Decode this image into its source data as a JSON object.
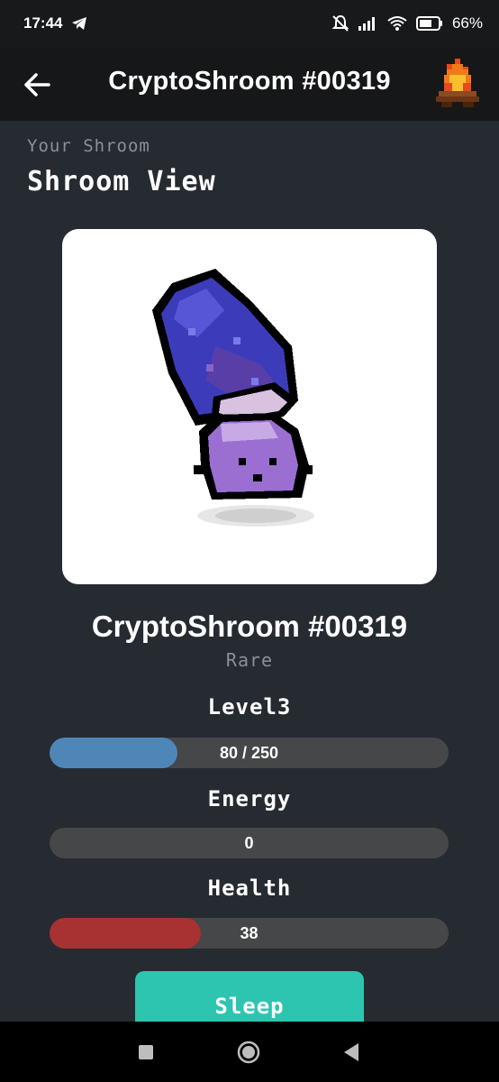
{
  "status_bar": {
    "time": "17:44",
    "battery": "66%",
    "icons": [
      "telegram-icon",
      "mute-icon",
      "signal-icon",
      "wifi-icon",
      "battery-icon"
    ]
  },
  "header": {
    "title": "CryptoShroom #00319",
    "back_icon": "arrow-left-icon",
    "campfire_icon": "campfire-icon"
  },
  "page": {
    "subheading": "Your Shroom",
    "heading": "Shroom View"
  },
  "shroom": {
    "name": "CryptoShroom #00319",
    "rarity": "Rare"
  },
  "stats": {
    "level": {
      "label": "Level3",
      "value": 80,
      "max": 250,
      "text": "80 / 250",
      "fraction": 0.32,
      "color": "#4f86b8"
    },
    "energy": {
      "label": "Energy",
      "value": 0,
      "text": "0",
      "fraction": 0,
      "color": "#4f86b8"
    },
    "health": {
      "label": "Health",
      "value": 38,
      "text": "38",
      "fraction": 0.38,
      "color": "#a83232"
    }
  },
  "actions": {
    "sleep_label": "Sleep"
  },
  "colors": {
    "background": "#262a31",
    "accent": "#2ec5b0",
    "bar_track": "#464748"
  }
}
